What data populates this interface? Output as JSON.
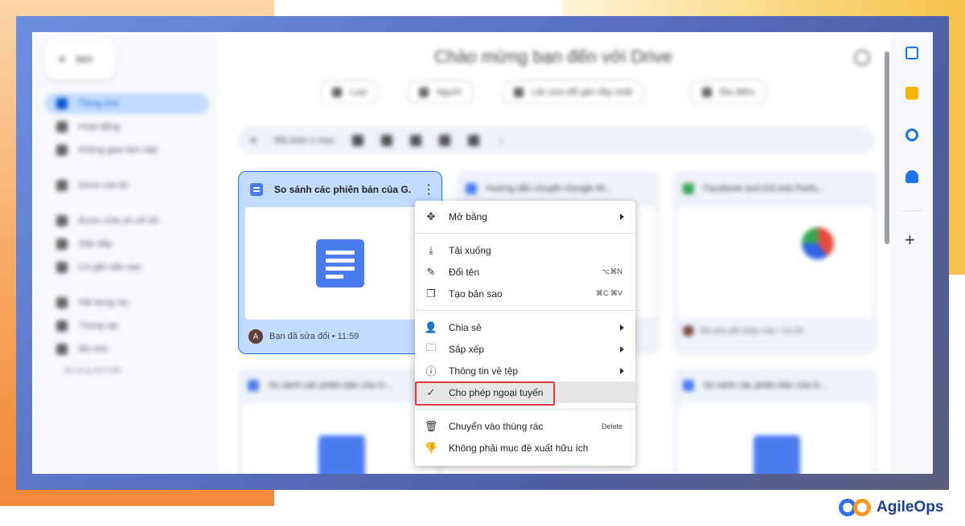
{
  "drive": {
    "title": "Chào mừng bạn đến với Drive",
    "new_label": "Mới",
    "nav": [
      "Trang chủ",
      "Hoạt động",
      "Không gian làm việc",
      "Drive của tôi",
      "Được chia sẻ với tôi",
      "Gần đây",
      "Có gắn dấu sao",
      "Nội dung rác",
      "Thùng rác",
      "Bộ nhớ"
    ],
    "storage_text": "Đã dùng 49,9 MB",
    "chips": [
      "Loại",
      "Người",
      "Lần sửa đổi gần đây nhất",
      "Địa điểm"
    ],
    "selection_text": "Đã chọn 1 mục",
    "cards": [
      {
        "name": "Hướng dẫn chuyển Google W...",
        "footer": ""
      },
      {
        "name": "Facebook and GG Ads Perfo...",
        "footer": "Đã sửa đổi nhãn này • 16:28"
      },
      {
        "name": "So sánh các phiên bản của G...",
        "footer": ""
      },
      {
        "name": "So sánh các phiên bản của G...",
        "footer": ""
      }
    ]
  },
  "selected_card": {
    "name": "So sánh các phiên bản của G...",
    "avatar": "A",
    "footer": "Bạn đã sửa đổi • 11:59"
  },
  "menu": {
    "open_with": "Mở bằng",
    "download": "Tải xuống",
    "rename": "Đổi tên",
    "rename_shortcut": "⌥⌘N",
    "copy": "Tạo bản sao",
    "copy_shortcut": "⌘C ⌘V",
    "share": "Chia sẻ",
    "organize": "Sắp xếp",
    "file_info": "Thông tin về tệp",
    "offline": "Cho phép ngoại tuyến",
    "trash": "Chuyển vào thùng rác",
    "trash_shortcut": "Delete",
    "not_helpful": "Không phải mục đề xuất hữu ích"
  },
  "brand": {
    "name": "AgileOps"
  },
  "colors": {
    "highlight_border": "#e0393e",
    "selected_card": "#c2dbff",
    "accent": "#1a73e8"
  }
}
